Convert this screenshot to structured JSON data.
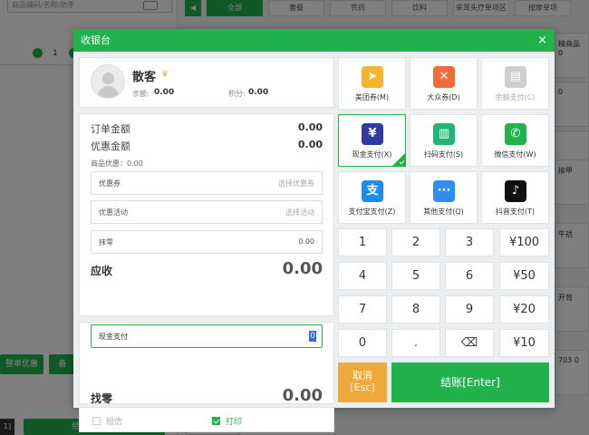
{
  "background": {
    "search_placeholder": "商品编码/名称/助手",
    "qty": "1",
    "order_discount": "整单优惠",
    "order_discount2": "备",
    "bottom_left": "1]",
    "checkout": "结算[Enter]",
    "add_goods": "新增商品",
    "categories": [
      "全部",
      "套餐",
      "农药",
      "饮料",
      "采耳头疗单项区",
      "按摩单项"
    ],
    "side_cards": [
      "精商品\n0",
      "0",
      "",
      "柳甲",
      "牛祜",
      "开背",
      "703\n0",
      ""
    ]
  },
  "dialog": {
    "title": "收银台",
    "close": "×"
  },
  "customer": {
    "name": "散客",
    "balance_label": "余额:",
    "balance": "0.00",
    "points_label": "积分:",
    "points": "0.00"
  },
  "amounts": {
    "order_label": "订单金额",
    "order_value": "0.00",
    "discount_label": "优惠金额",
    "discount_value": "0.00",
    "goods_discount": "商品优惠：0.00",
    "coupon_label": "优惠券",
    "coupon_placeholder": "选择优惠券",
    "activity_label": "优惠活动",
    "activity_placeholder": "选择活动",
    "rounding_label": "抹零",
    "rounding_value": "0.00",
    "due_label": "应收",
    "due_value": "0.00"
  },
  "payment": {
    "method_label": "现金支付",
    "input_value": "0",
    "change_label": "找零",
    "change_value": "0.00"
  },
  "options": {
    "sms_label": "短信",
    "print_label": "打印"
  },
  "pay_methods": [
    {
      "label": "美团券(M)",
      "color": "#f7b52c",
      "glyph": "➤"
    },
    {
      "label": "大众券(D)",
      "color": "#f26b3a",
      "glyph": "✕"
    },
    {
      "label": "余额支付(C)",
      "color": "#cfcfcf",
      "glyph": "▤"
    },
    {
      "label": "现金支付(X)",
      "color": "#2f3b9f",
      "glyph": "¥"
    },
    {
      "label": "扫码支付(S)",
      "color": "#22b573",
      "glyph": "▥"
    },
    {
      "label": "微信支付(W)",
      "color": "#21b24e",
      "glyph": "✆"
    },
    {
      "label": "支付宝支付(Z)",
      "color": "#1a8ef0",
      "glyph": "支"
    },
    {
      "label": "其他支付(Q)",
      "color": "#2f8ef0",
      "glyph": "···"
    },
    {
      "label": "抖音支付(T)",
      "color": "#111111",
      "glyph": "♪"
    }
  ],
  "keypad": [
    "1",
    "2",
    "3",
    "¥100",
    "4",
    "5",
    "6",
    "¥50",
    "7",
    "8",
    "9",
    "¥20",
    "0",
    ".",
    "⌫",
    "¥10"
  ],
  "buttons": {
    "cancel_line1": "取消",
    "cancel_line2": "[Esc]",
    "checkout": "结账[Enter]"
  },
  "colors": {
    "accent": "#21b24e",
    "cancel": "#f2a93b"
  }
}
